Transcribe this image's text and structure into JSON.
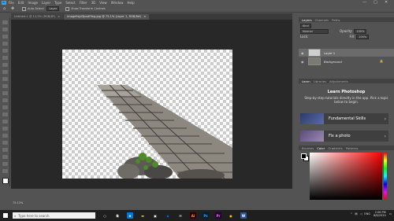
{
  "app": {
    "menu": [
      "File",
      "Edit",
      "Image",
      "Layer",
      "Type",
      "Select",
      "Filter",
      "3D",
      "View",
      "Window",
      "Help"
    ],
    "win_controls": [
      "—",
      "□",
      "✕"
    ]
  },
  "options": {
    "auto_select_label": "Auto-Select:",
    "auto_select_value": "Layer",
    "show_transform": "Show Transform Controls"
  },
  "tabs": [
    {
      "label": "Untitled-1 @ 12.5% (RGB/8*)",
      "close": "×"
    },
    {
      "label": "image9sjd3jvsdf9eg.jpg @ 75.1% (Layer 1, RGB/8#)",
      "close": "×"
    }
  ],
  "status": {
    "zoom": "75.13%"
  },
  "layers_panel": {
    "tabs": [
      "Layers",
      "Channels",
      "Paths"
    ],
    "kind": "Kind",
    "blend_mode": "Normal",
    "opacity_label": "Opacity:",
    "opacity_value": "100%",
    "lock_label": "Lock:",
    "fill_label": "Fill:",
    "fill_value": "100%",
    "layers": [
      {
        "name": "Layer 1",
        "selected": true
      },
      {
        "name": "Background",
        "selected": false
      }
    ]
  },
  "learn_panel": {
    "tabs": [
      "Learn",
      "Libraries",
      "Adjustments"
    ],
    "title": "Learn Photoshop",
    "description": "Step-by-step tutorials directly in the app. Pick a topic below to begin.",
    "cards": [
      {
        "label": "Fundamental Skills"
      },
      {
        "label": "Fix a photo"
      }
    ]
  },
  "color_panel": {
    "tabs": [
      "Brushes",
      "Color",
      "Gradients",
      "Patterns"
    ]
  },
  "taskbar": {
    "search_placeholder": "Type here to search",
    "time": "2:06 PM",
    "date": "8/8/2020",
    "lang": "ENG",
    "app_icons": [
      {
        "icon": "cortana-icon",
        "label": "○",
        "color": "#ffffff",
        "bg": "transparent"
      },
      {
        "icon": "task-view-icon",
        "label": "⧉",
        "color": "#ffffff",
        "bg": "transparent"
      },
      {
        "icon": "edge-icon",
        "label": "e",
        "color": "#ffffff",
        "bg": "#0078d7"
      },
      {
        "icon": "file-explorer-icon",
        "label": "▬",
        "color": "#f7c948",
        "bg": "transparent"
      },
      {
        "icon": "store-icon",
        "label": "▣",
        "color": "#ffffff",
        "bg": "transparent"
      },
      {
        "icon": "dropbox-icon",
        "label": "◆",
        "color": "#0061fe",
        "bg": "transparent"
      },
      {
        "icon": "mail-icon",
        "label": "✉",
        "color": "#ffffff",
        "bg": "transparent"
      },
      {
        "icon": "illustrator-icon",
        "label": "Ai",
        "color": "#ff9a00",
        "bg": "#330000"
      },
      {
        "icon": "photoshop-icon",
        "label": "Ps",
        "color": "#31a8ff",
        "bg": "#001e36"
      },
      {
        "icon": "premiere-icon",
        "label": "Pr",
        "color": "#ea77ff",
        "bg": "#2a0033"
      },
      {
        "icon": "chrome-icon",
        "label": "●",
        "color": "#fbbc05",
        "bg": "transparent"
      },
      {
        "icon": "word-icon",
        "label": "W",
        "color": "#ffffff",
        "bg": "#2b579a"
      }
    ]
  }
}
